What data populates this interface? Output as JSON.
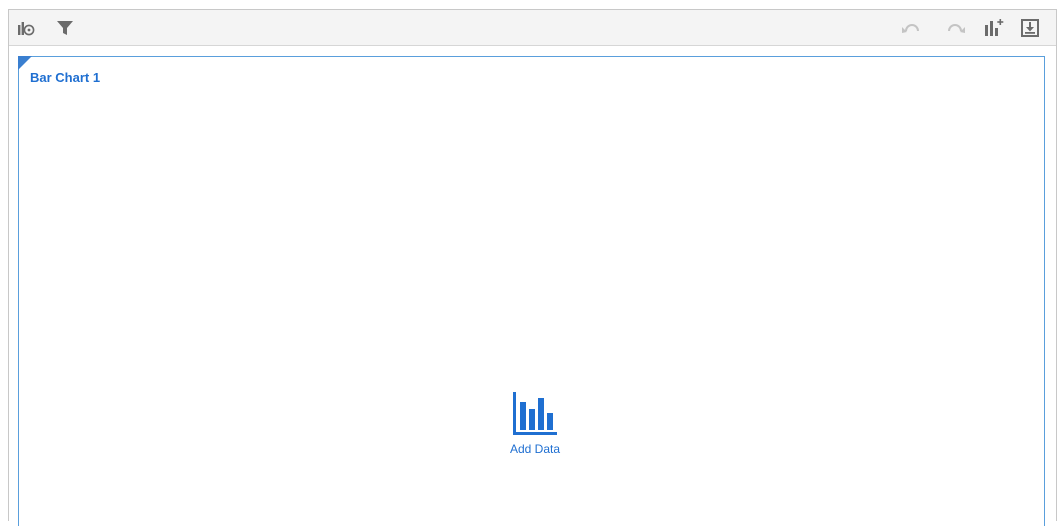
{
  "toolbar": {
    "left_icons": [
      "chart-properties-icon",
      "filter-icon"
    ],
    "right_icons": [
      "undo-icon",
      "redo-icon",
      "add-visualization-icon",
      "export-icon"
    ]
  },
  "visualization": {
    "title": "Bar Chart 1",
    "placeholder_action": "Add Data",
    "placeholder_icon": "bar-chart-icon"
  },
  "colors": {
    "accent": "#1f6fd1",
    "toolbar_icon": "#6b6b6b",
    "disabled_icon": "#c4c4c4",
    "canvas_border": "#5a9fdc"
  }
}
